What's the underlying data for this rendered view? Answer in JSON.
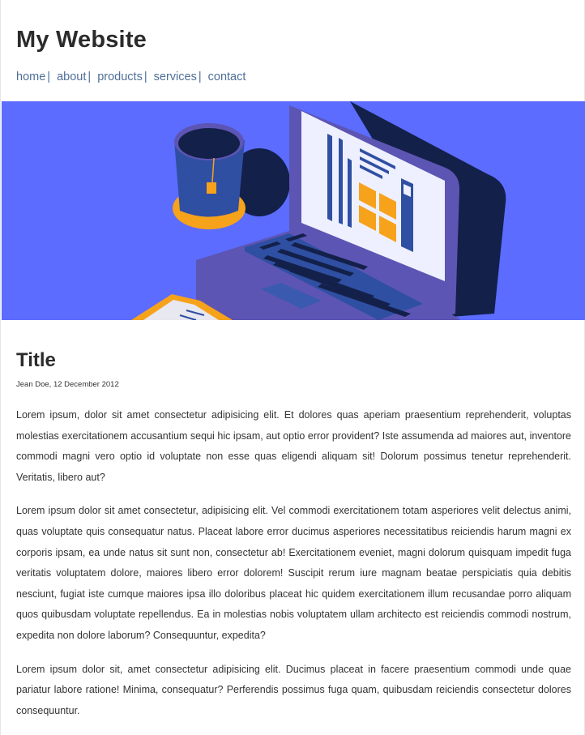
{
  "site": {
    "title": "My Website"
  },
  "nav": {
    "items": [
      {
        "label": "home"
      },
      {
        "label": "about"
      },
      {
        "label": "products"
      },
      {
        "label": "services"
      },
      {
        "label": "contact"
      }
    ],
    "separator": "|"
  },
  "hero": {
    "icon": "laptop-desk-illustration-icon",
    "colors": {
      "background": "#5b6cff",
      "laptop": "#5d55b3",
      "shadow": "#13204a",
      "accent": "#f7a21b",
      "screen": "#eef0ff",
      "mug": "#2f4fa2"
    }
  },
  "post": {
    "title": "Title",
    "meta": "Jean Doe, 12 December 2012",
    "paragraphs": [
      "Lorem ipsum, dolor sit amet consectetur adipisicing elit. Et dolores quas aperiam praesentium reprehenderit, voluptas molestias exercitationem accusantium sequi hic ipsam, aut optio error provident? Iste assumenda ad maiores aut, inventore commodi magni vero optio id voluptate non esse quas eligendi aliquam sit! Dolorum possimus tenetur reprehenderit. Veritatis, libero aut?",
      "Lorem ipsum dolor sit amet consectetur, adipisicing elit. Vel commodi exercitationem totam asperiores velit delectus animi, quas voluptate quis consequatur natus. Placeat labore error ducimus asperiores necessitatibus reiciendis harum magni ex corporis ipsam, ea unde natus sit sunt non, consectetur ab! Exercitationem eveniet, magni dolorum quisquam impedit fuga veritatis voluptatem dolore, maiores libero error dolorem! Suscipit rerum iure magnam beatae perspiciatis quia debitis nesciunt, fugiat iste cumque maiores ipsa illo doloribus placeat hic quidem exercitationem illum recusandae porro aliquam quos quibusdam voluptate repellendus. Ea in molestias nobis voluptatem ullam architecto est reiciendis commodi nostrum, expedita non dolore laborum? Consequuntur, expedita?",
      "Lorem ipsum dolor sit, amet consectetur adipisicing elit. Ducimus placeat in facere praesentium commodi unde quae pariatur labore ratione! Minima, consequatur? Perferendis possimus fuga quam, quibusdam reiciendis consectetur dolores consequuntur."
    ]
  }
}
